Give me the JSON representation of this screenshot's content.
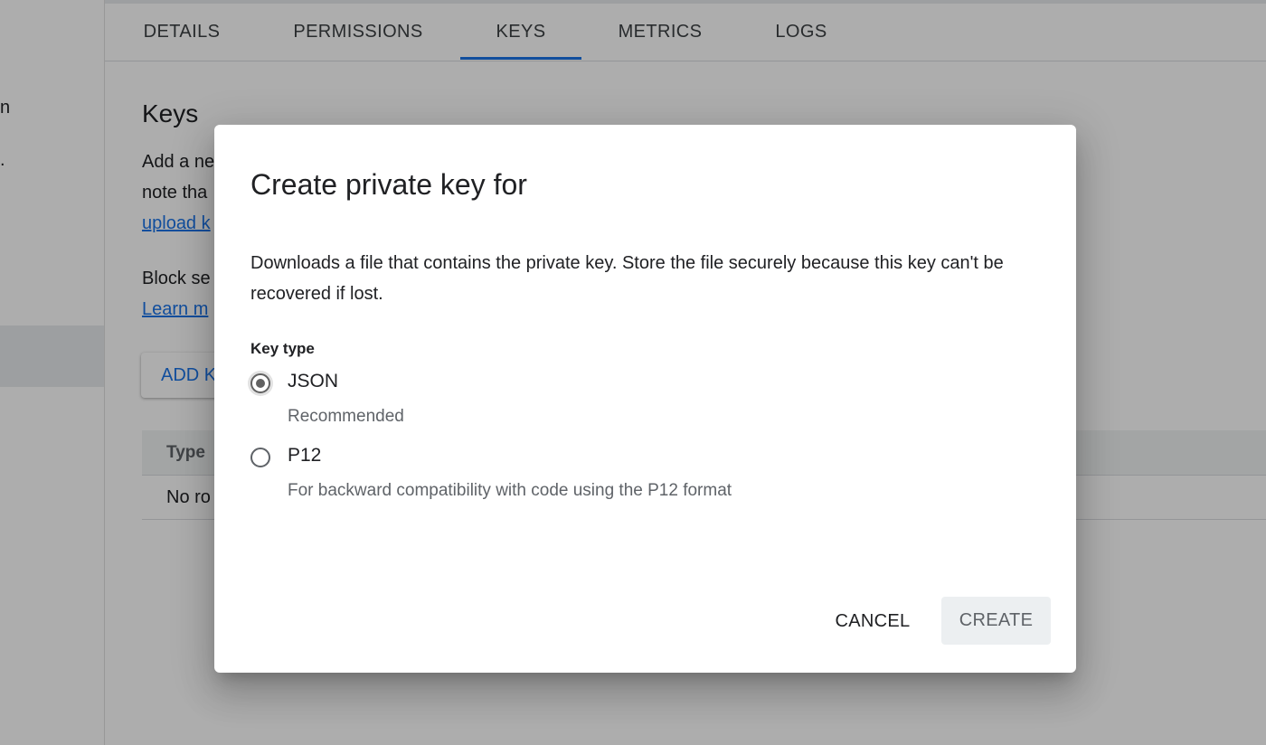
{
  "background": {
    "left_nav_fragments": [
      "n",
      "."
    ],
    "tabs": [
      {
        "label": "DETAILS"
      },
      {
        "label": "PERMISSIONS"
      },
      {
        "label": "KEYS",
        "active": true
      },
      {
        "label": "METRICS"
      },
      {
        "label": "LOGS"
      }
    ],
    "section_title": "Keys",
    "desc_line1": "Add a ne",
    "desc_line2": "note tha",
    "desc_link": "upload k",
    "block_line": "Block se",
    "learn_link": "Learn m",
    "add_key_button": "ADD K",
    "table": {
      "header_type": "Type",
      "empty_row": "No ro"
    }
  },
  "dialog": {
    "title": "Create private key for",
    "description": "Downloads a file that contains the private key. Store the file securely because this key can't be recovered if lost.",
    "key_type_label": "Key type",
    "options": [
      {
        "label": "JSON",
        "hint": "Recommended",
        "selected": true
      },
      {
        "label": "P12",
        "hint": "For backward compatibility with code using the P12 format",
        "selected": false
      }
    ],
    "cancel_label": "CANCEL",
    "create_label": "CREATE"
  },
  "colors": {
    "accent": "#1a73e8",
    "radio_selected": "#616161",
    "create_button_bg": "#eceff1"
  }
}
